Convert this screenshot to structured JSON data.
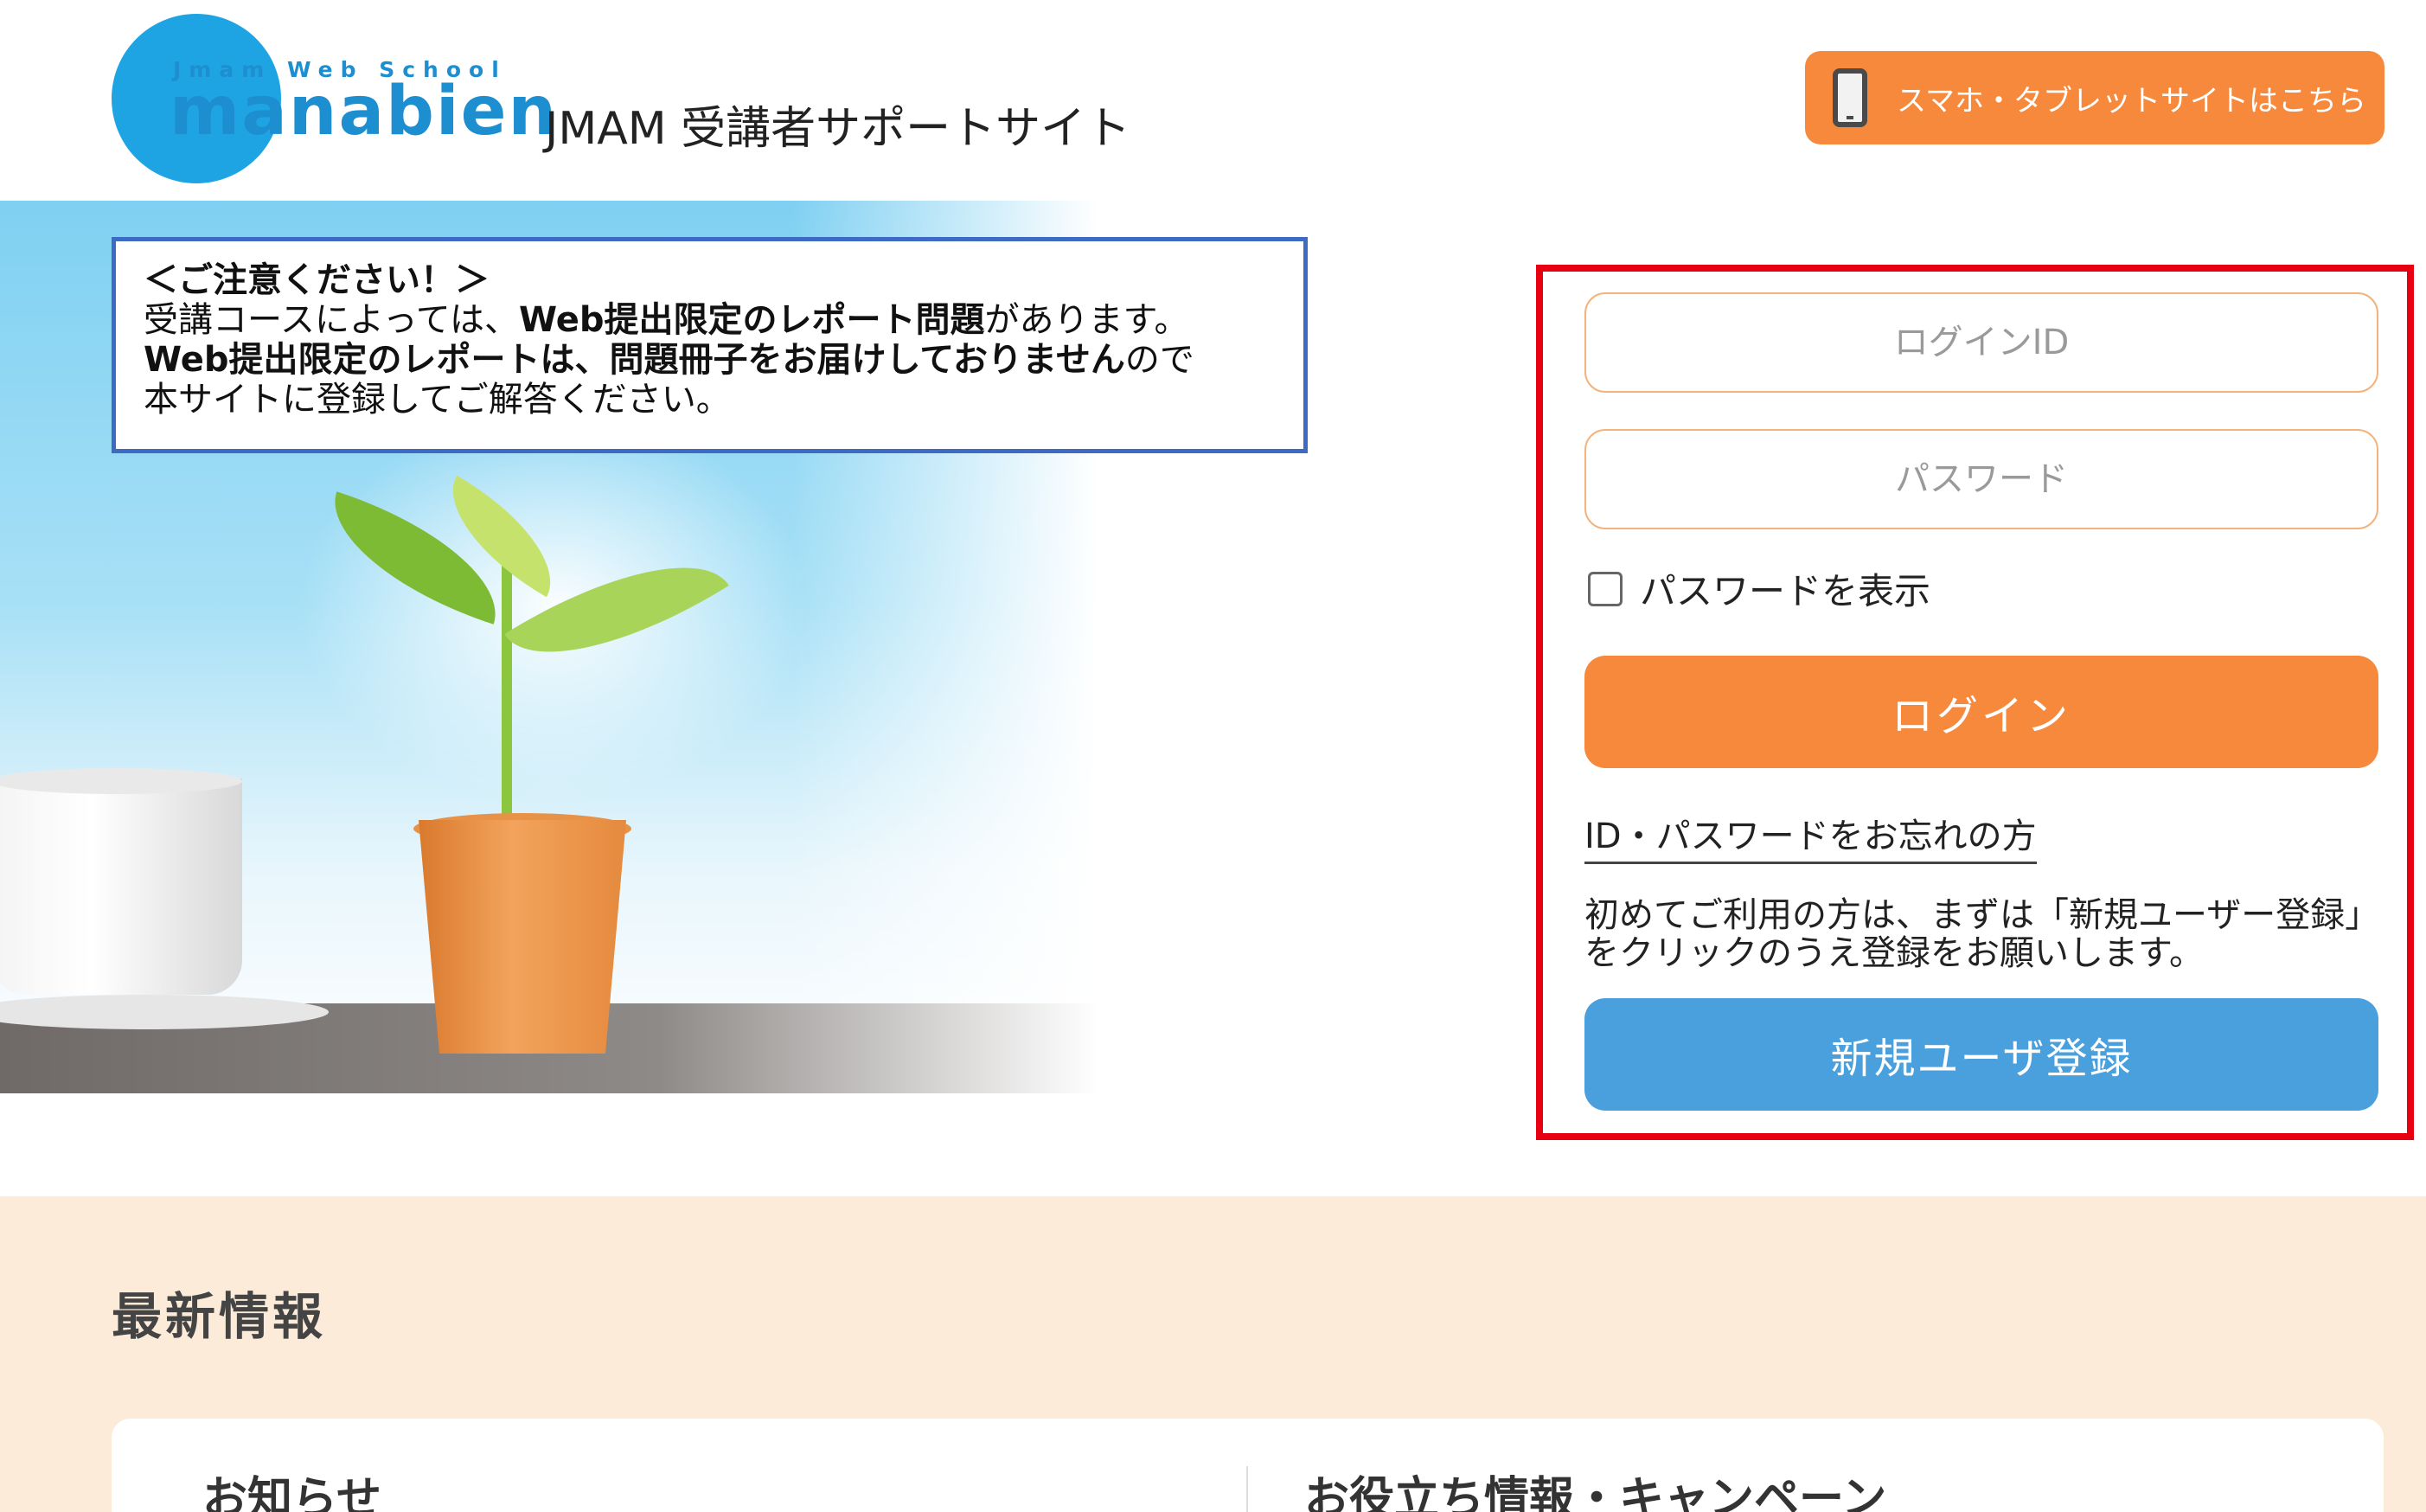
{
  "header": {
    "logo_tagline": "Jmam Web School",
    "logo_brand": "manabien",
    "site_title": "JMAM 受講者サポートサイト",
    "mobile_link_label": "スマホ・タブレットサイトはこちら"
  },
  "notice": {
    "heading": "＜ご注意ください！＞",
    "line1_pre": "受講コースによっては、",
    "line1_bold": "Web提出限定のレポート問題",
    "line1_post": "があります。",
    "line2_bold": "Web提出限定のレポートは、問題冊子をお届けしておりません",
    "line2_post": "ので",
    "line3": "本サイトに登録してご解答ください。"
  },
  "login": {
    "id_placeholder": "ログインID",
    "password_placeholder": "パスワード",
    "show_password_label": "パスワードを表示",
    "show_password_checked": false,
    "login_button": "ログイン",
    "forgot_link": "ID・パスワードをお忘れの方",
    "first_time_text": "初めてご利用の方は、まずは「新規ユーザー登録」をクリックのうえ登録をお願いします。",
    "register_button": "新規ユーザ登録"
  },
  "news": {
    "title": "最新情報",
    "col1_heading": "お知らせ",
    "col2_heading": "お役立ち情報・キャンペーン"
  },
  "colors": {
    "accent_orange": "#f7893d",
    "accent_blue": "#4aa0dc",
    "highlight_red": "#e60012",
    "notice_border": "#3d6bc4",
    "news_bg": "#fdebd9"
  },
  "icons": {
    "mobile_link": "smartphone-icon",
    "show_password": "checkbox"
  }
}
